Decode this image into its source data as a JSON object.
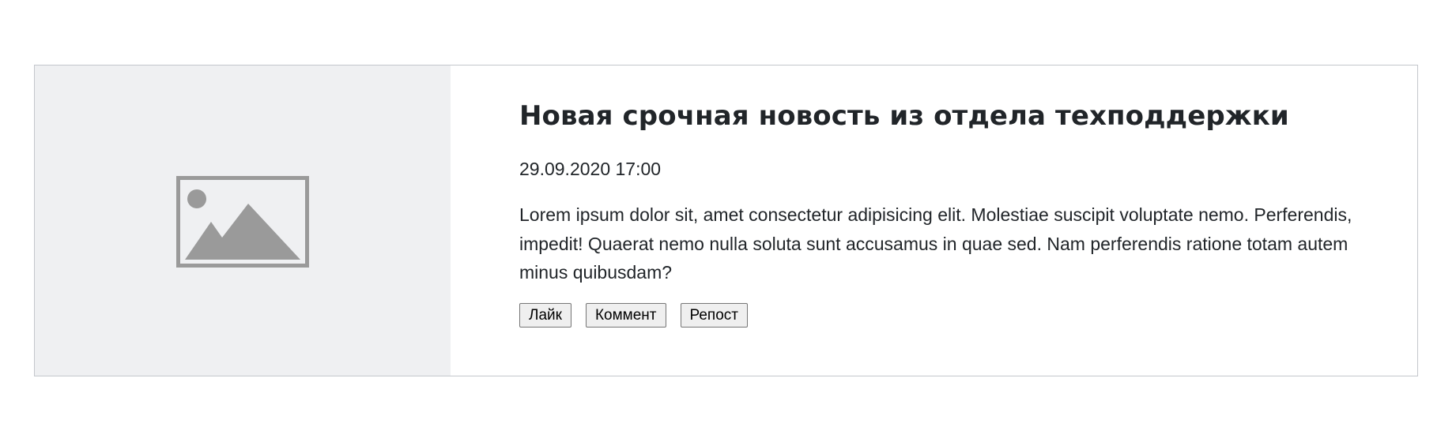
{
  "news": {
    "title": "Новая срочная новость из отдела техподдержки",
    "date": "29.09.2020 17:00",
    "text": "Lorem ipsum dolor sit, amet consectetur adipisicing elit. Molestiae suscipit voluptate nemo. Perferendis, impedit! Quaerat nemo nulla soluta sunt accusamus in quae sed. Nam perferendis ratione totam autem minus quibusdam?",
    "image_icon": "image-placeholder-icon",
    "actions": {
      "like_label": "Лайк",
      "comment_label": "Коммент",
      "repost_label": "Репост"
    }
  },
  "colors": {
    "media_background": "#eff0f2",
    "placeholder_icon": "#9a9a9a",
    "card_border": "#c4c7cc",
    "text": "#212529"
  }
}
